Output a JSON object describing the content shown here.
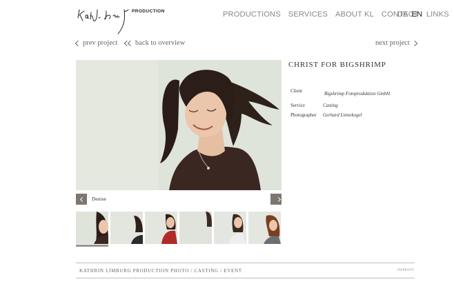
{
  "brand": {
    "production_label": "PRODUCTION"
  },
  "nav": {
    "items": [
      "PRODUCTIONS",
      "SERVICES",
      "ABOUT KL",
      "CONTACT",
      "LINKS"
    ],
    "languages": [
      "DE",
      "EN"
    ],
    "active_language": "EN"
  },
  "project_nav": {
    "prev": "prev project",
    "overview": "back to overview",
    "next": "next project"
  },
  "project": {
    "title": "CHRIST FOR BIGSHRIMP",
    "caption": "Denise",
    "details": [
      {
        "label": "Client",
        "value": "Bigshrimp Fotoproduktion GmbH"
      },
      {
        "label": "Service",
        "value": "Casting"
      },
      {
        "label": "Photographer",
        "value": "Gerhard Linnekogel"
      }
    ]
  },
  "icons": {
    "prev_project": "chevron-left-icon",
    "overview": "double-chevron-left-icon",
    "next_project": "chevron-right-icon",
    "gallery_prev": "chevron-left-icon",
    "gallery_next": "chevron-right-icon"
  },
  "colors": {
    "gallery_button": "#7d766f",
    "photo_background": "#dfe4db",
    "rule": "#bdbdbd"
  },
  "footer": {
    "left": "KATHRIN LIMBURG PRODUCTION PHOTO / CASTING / EVENT",
    "right": "IMPRINT"
  }
}
